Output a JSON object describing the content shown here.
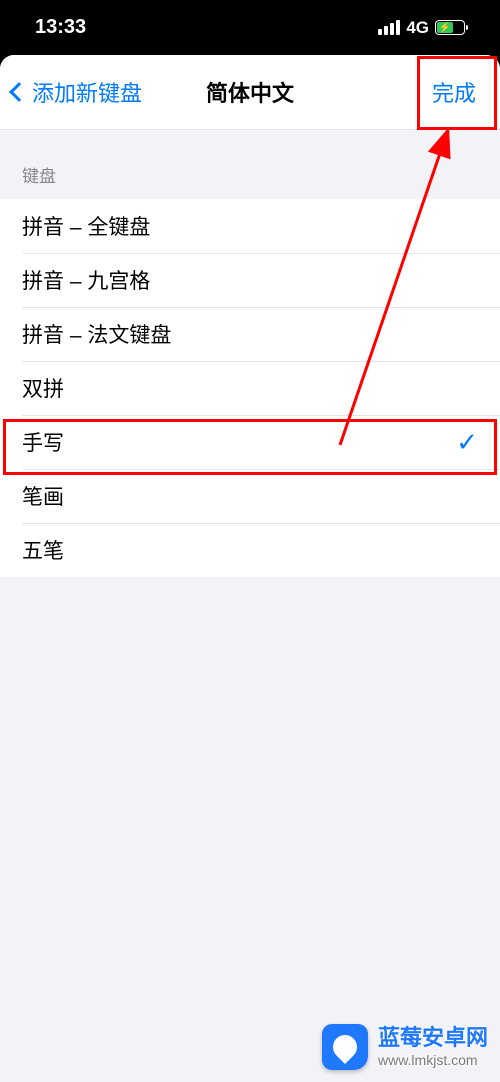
{
  "status": {
    "time": "13:33",
    "network": "4G"
  },
  "nav": {
    "back_label": "添加新键盘",
    "title": "简体中文",
    "done_label": "完成"
  },
  "section": {
    "header": "键盘"
  },
  "keyboards": [
    {
      "label": "拼音 – 全键盘",
      "selected": false
    },
    {
      "label": "拼音 – 九宫格",
      "selected": false
    },
    {
      "label": "拼音 – 法文键盘",
      "selected": false
    },
    {
      "label": "双拼",
      "selected": false
    },
    {
      "label": "手写",
      "selected": true
    },
    {
      "label": "笔画",
      "selected": false
    },
    {
      "label": "五笔",
      "selected": false
    }
  ],
  "watermark": {
    "title": "蓝莓安卓网",
    "url": "www.lmkjst.com"
  }
}
